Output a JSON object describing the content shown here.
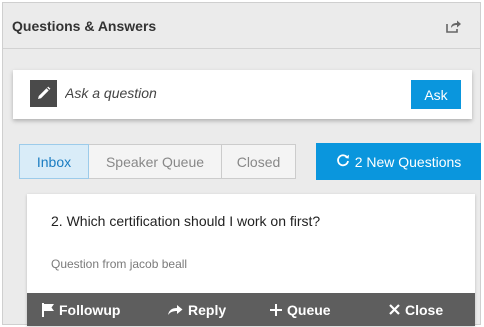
{
  "header": {
    "title": "Questions & Answers",
    "share_icon": "share-icon"
  },
  "ask": {
    "icon": "pencil-icon",
    "placeholder": "Ask a question",
    "button_label": "Ask"
  },
  "tabs": [
    {
      "label": "Inbox",
      "active": true
    },
    {
      "label": "Speaker Queue",
      "active": false
    },
    {
      "label": "Closed",
      "active": false
    }
  ],
  "new_questions": {
    "icon": "refresh-icon",
    "label": "2 New Questions"
  },
  "question": {
    "text": "2. Which certification should I work on first?",
    "from": "Question from jacob beall"
  },
  "actions": [
    {
      "label": "Followup",
      "icon": "flag-icon"
    },
    {
      "label": "Reply",
      "icon": "reply-arrow-icon"
    },
    {
      "label": "Queue",
      "icon": "plus-icon"
    },
    {
      "label": "Close",
      "icon": "x-icon"
    }
  ],
  "colors": {
    "accent": "#0a96dd",
    "action_bar": "#5e5e5e",
    "active_tab_bg": "#d9ecf8",
    "active_tab_text": "#1b7dc2"
  }
}
